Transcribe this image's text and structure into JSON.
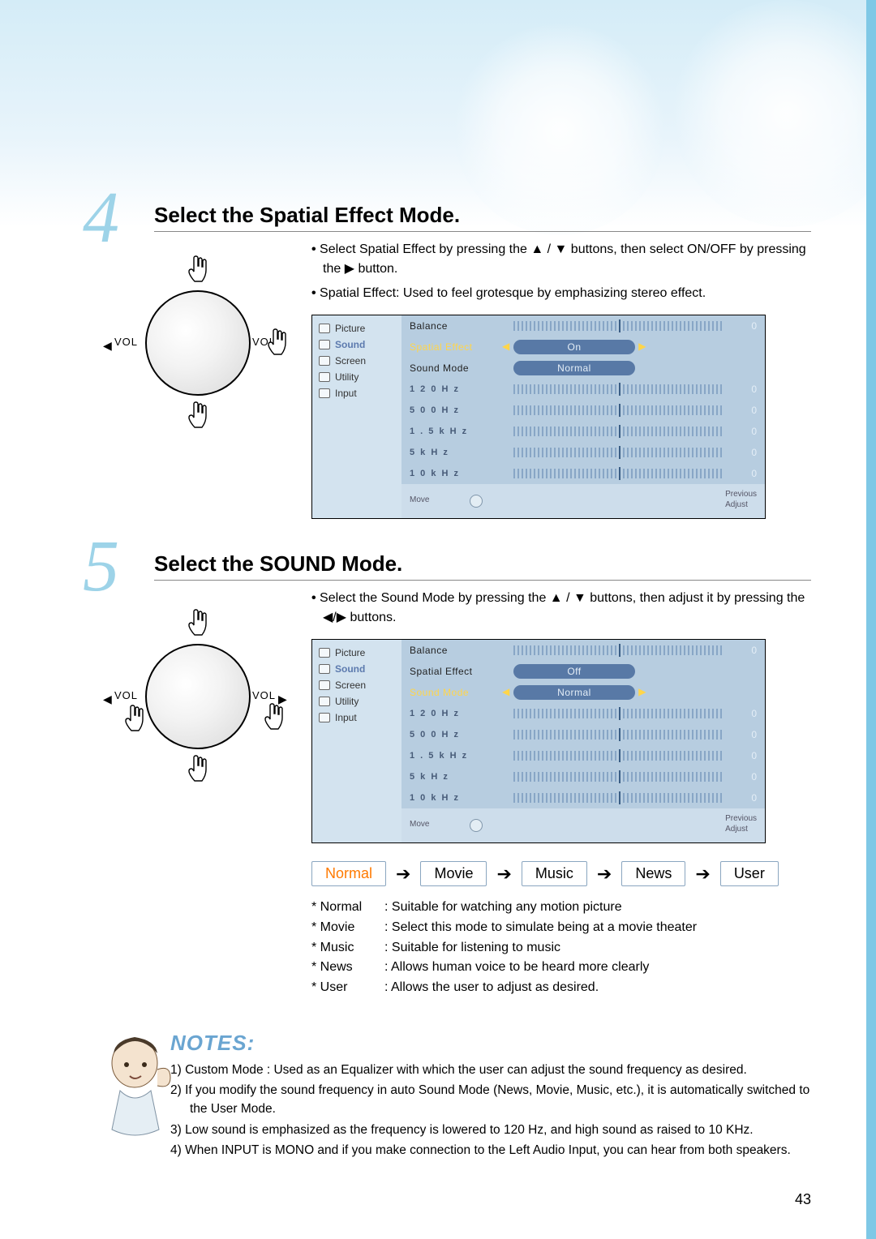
{
  "page_number": "43",
  "remote": {
    "vol": "VOL"
  },
  "steps": [
    {
      "num": "4",
      "title": "Select the Spatial Effect Mode.",
      "bullets": [
        "Select Spatial Effect by pressing the ▲ / ▼ buttons, then select ON/OFF by pressing the ▶ button.",
        "Spatial Effect: Used to feel grotesque by emphasizing stereo effect."
      ],
      "osd": {
        "menu": [
          "Picture",
          "Sound",
          "Screen",
          "Utility",
          "Input"
        ],
        "menu_selected": 1,
        "highlight_row": 1,
        "rows": [
          {
            "label": "Balance",
            "type": "bar",
            "value": "0"
          },
          {
            "label": "Spatial Effect",
            "type": "pill",
            "value": "On"
          },
          {
            "label": "Sound Mode",
            "type": "pill",
            "value": "Normal"
          },
          {
            "label": "1 2 0   H z",
            "type": "bar",
            "value": "0",
            "small": true
          },
          {
            "label": "5 0 0   H z",
            "type": "bar",
            "value": "0",
            "small": true
          },
          {
            "label": "1 . 5   k H z",
            "type": "bar",
            "value": "0",
            "small": true
          },
          {
            "label": "5       k H z",
            "type": "bar",
            "value": "0",
            "small": true
          },
          {
            "label": "1 0     k H z",
            "type": "bar",
            "value": "0",
            "small": true
          }
        ],
        "footer": {
          "left": "Move",
          "right1": "Previous",
          "right2": "Adjust"
        }
      }
    },
    {
      "num": "5",
      "title": "Select the SOUND Mode.",
      "bullets": [
        "Select the Sound Mode by pressing the ▲ / ▼ buttons, then adjust it by pressing the ◀/▶ buttons."
      ],
      "osd": {
        "menu": [
          "Picture",
          "Sound",
          "Screen",
          "Utility",
          "Input"
        ],
        "menu_selected": 1,
        "highlight_row": 2,
        "rows": [
          {
            "label": "Balance",
            "type": "bar",
            "value": "0"
          },
          {
            "label": "Spatial Effect",
            "type": "pill",
            "value": "Off"
          },
          {
            "label": "Sound Mode",
            "type": "pill",
            "value": "Normal"
          },
          {
            "label": "1 2 0   H z",
            "type": "bar",
            "value": "0",
            "small": true
          },
          {
            "label": "5 0 0   H z",
            "type": "bar",
            "value": "0",
            "small": true
          },
          {
            "label": "1 . 5   k H z",
            "type": "bar",
            "value": "0",
            "small": true
          },
          {
            "label": "5       k H z",
            "type": "bar",
            "value": "0",
            "small": true
          },
          {
            "label": "1 0     k H z",
            "type": "bar",
            "value": "0",
            "small": true
          }
        ],
        "footer": {
          "left": "Move",
          "right1": "Previous",
          "right2": "Adjust"
        }
      },
      "modes": [
        "Normal",
        "Movie",
        "Music",
        "News",
        "User"
      ],
      "mode_active": 0,
      "defs": [
        {
          "t": "* Normal",
          "d": ": Suitable for watching any motion picture"
        },
        {
          "t": "* Movie",
          "d": ": Select this mode to simulate being at a movie theater"
        },
        {
          "t": "* Music",
          "d": ": Suitable for listening to music"
        },
        {
          "t": "* News",
          "d": ": Allows human voice to be heard more clearly"
        },
        {
          "t": "* User",
          "d": ": Allows the user to adjust as desired."
        }
      ]
    }
  ],
  "notes": {
    "heading": "NOTES:",
    "items": [
      "1) Custom Mode : Used as an Equalizer with which the user can adjust the sound frequency as desired.",
      "2) If you modify the sound frequency in auto Sound Mode (News, Movie, Music, etc.), it is automatically switched to the User Mode.",
      "3) Low sound is emphasized as the frequency is lowered to 120 Hz, and high sound as raised to 10 KHz.",
      "4) When INPUT is MONO and if you make connection to the Left Audio Input, you can hear from both speakers."
    ]
  }
}
